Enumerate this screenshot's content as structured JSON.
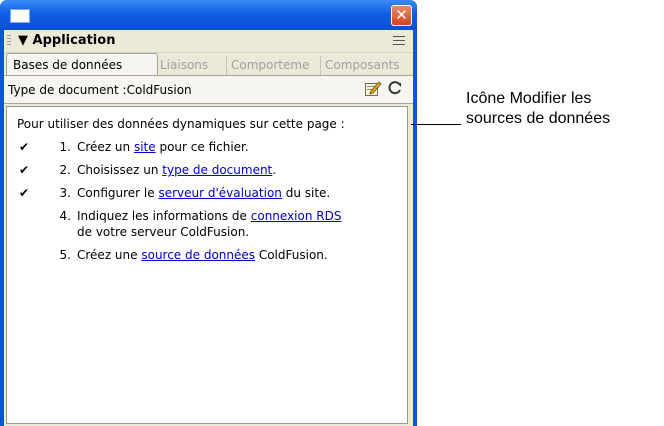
{
  "panel": {
    "title": "Application",
    "tabs": [
      "Bases de données",
      "Liaisons",
      "Comporteme",
      "Composants"
    ],
    "doctype": "Type de document :ColdFusion"
  },
  "content": {
    "intro": "Pour utiliser des données dynamiques sur cette page :",
    "steps": [
      {
        "check": "✔",
        "num": "1.",
        "before": "Créez un ",
        "link": "site",
        "after": " pour ce fichier."
      },
      {
        "check": "✔",
        "num": "2.",
        "before": "Choisissez un ",
        "link": "type de document",
        "after": "."
      },
      {
        "check": "✔",
        "num": "3.",
        "before": "Configurer le ",
        "link": "serveur d'évaluation",
        "after": " du site."
      },
      {
        "check": "",
        "num": "4.",
        "before": "Indiquez les informations de ",
        "link": "connexion RDS",
        "after": "de votre serveur ColdFusion."
      },
      {
        "check": "",
        "num": "5.",
        "before": "Créez une ",
        "link": "source de données",
        "after": " ColdFusion."
      }
    ]
  },
  "callout": {
    "line1": "Icône Modifier les",
    "line2": "sources de données"
  },
  "window": {
    "close_glyph": "✕"
  }
}
